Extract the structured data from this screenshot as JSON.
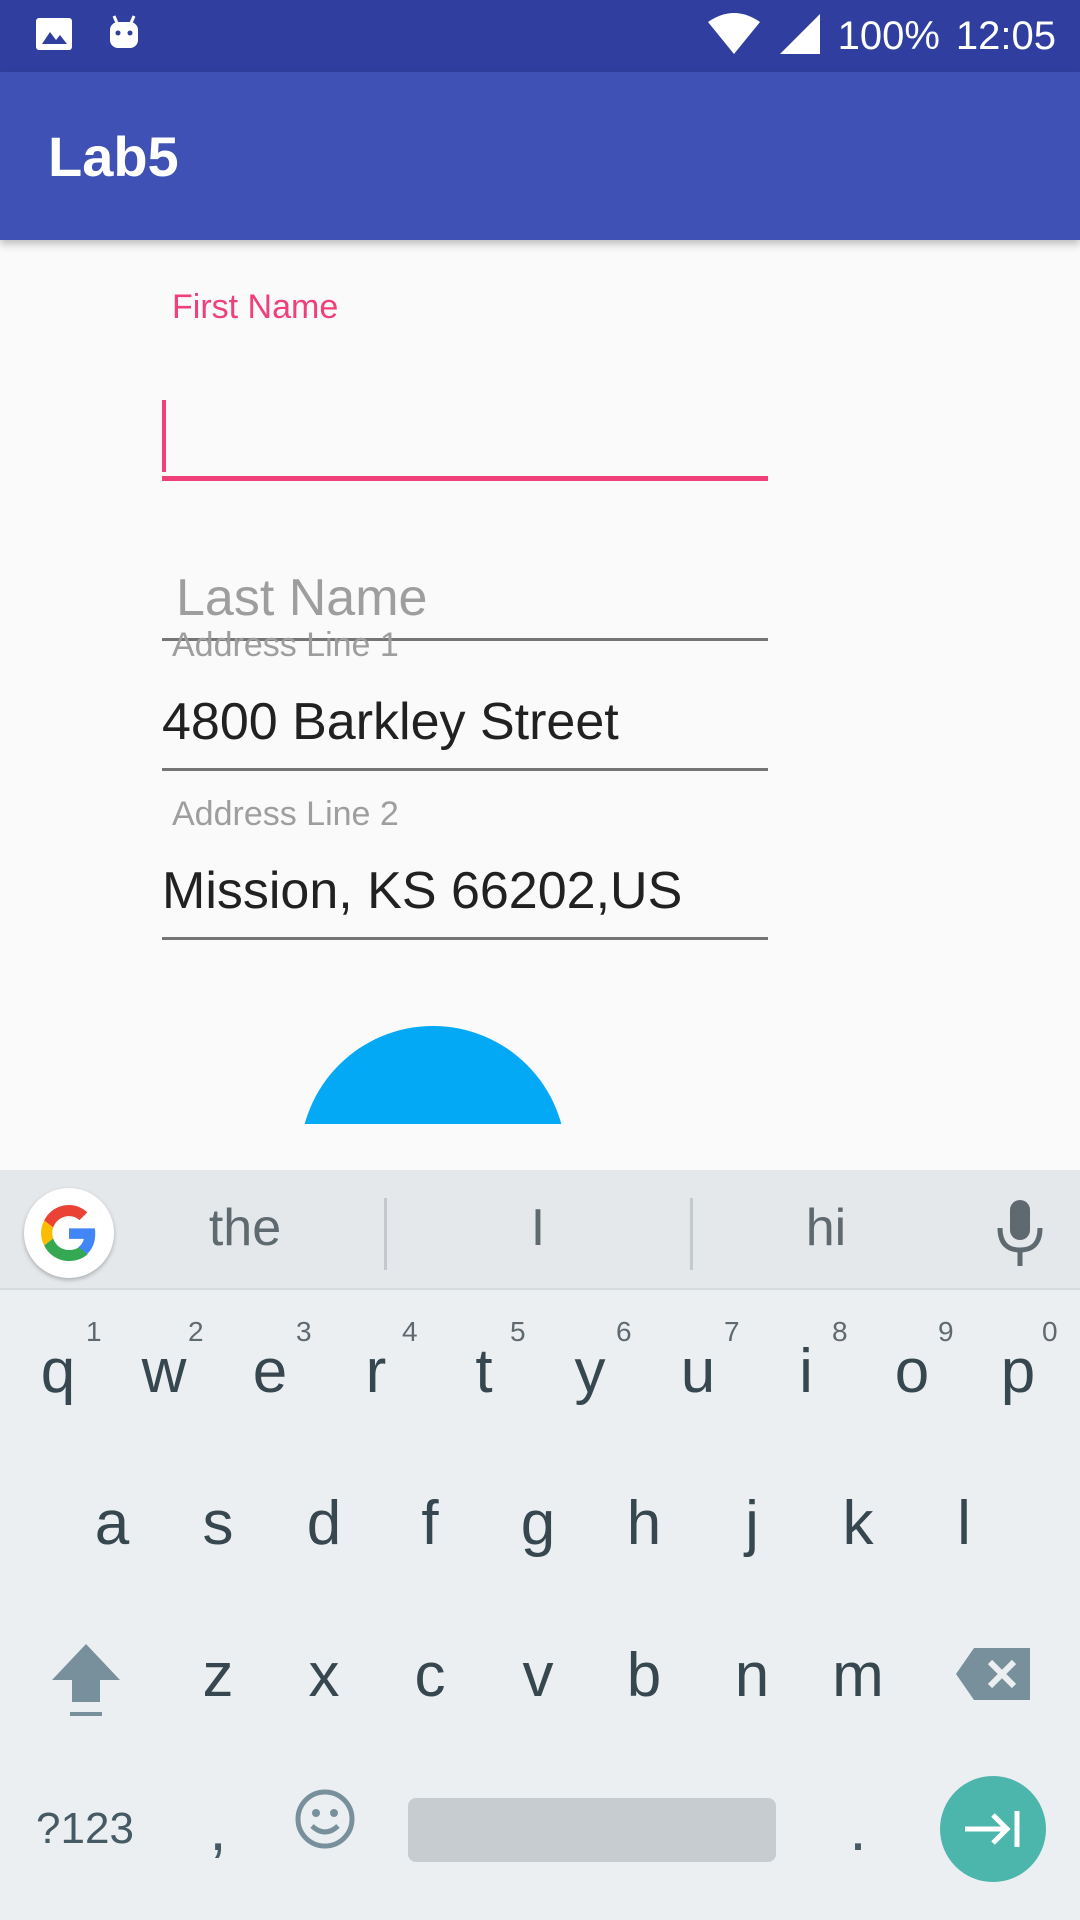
{
  "status_bar": {
    "battery": "100%",
    "time": "12:05",
    "icons": [
      "image-icon",
      "android-icon",
      "wifi-icon",
      "signal-icon"
    ]
  },
  "app_bar": {
    "title": "Lab5"
  },
  "form": {
    "first_name": {
      "label": "First Name",
      "value": ""
    },
    "last_name": {
      "placeholder": "Last Name",
      "value": ""
    },
    "address_line_1": {
      "label": "Address Line 1",
      "value": "4800 Barkley Street"
    },
    "address_line_2": {
      "label": "Address Line 2",
      "value": "Mission, KS 66202,US"
    }
  },
  "colors": {
    "status_bar": "#303F9F",
    "app_bar": "#3F51B5",
    "accent": "#F0407A",
    "dome": "#03A9F4",
    "enter": "#4DB6AC"
  },
  "keyboard": {
    "suggestions": [
      "the",
      "I",
      "hi"
    ],
    "row1": [
      "q",
      "w",
      "e",
      "r",
      "t",
      "y",
      "u",
      "i",
      "o",
      "p"
    ],
    "row1_hints": [
      "1",
      "2",
      "3",
      "4",
      "5",
      "6",
      "7",
      "8",
      "9",
      "0"
    ],
    "row2": [
      "a",
      "s",
      "d",
      "f",
      "g",
      "h",
      "j",
      "k",
      "l"
    ],
    "row3": [
      "z",
      "x",
      "c",
      "v",
      "b",
      "n",
      "m"
    ],
    "symbols_label": "?123",
    "comma": ",",
    "period": "."
  }
}
